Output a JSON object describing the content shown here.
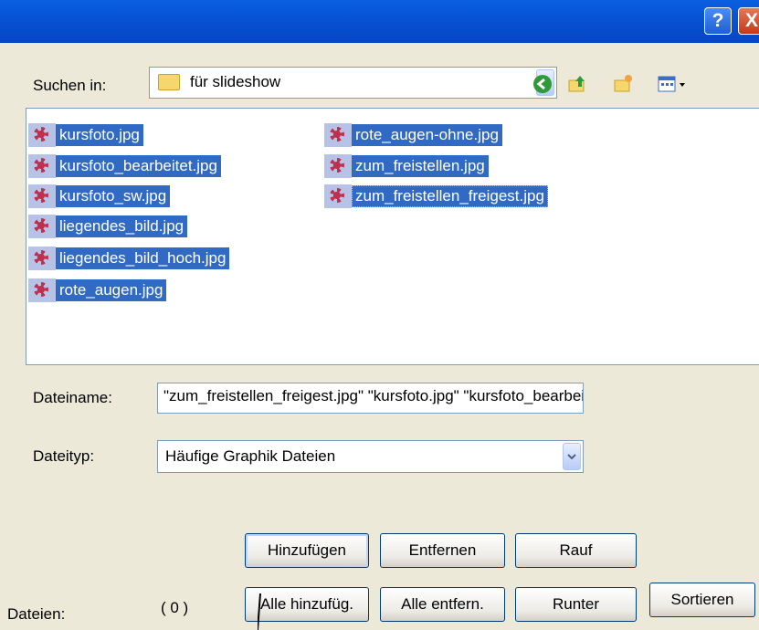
{
  "titlebar": {
    "help_glyph": "?",
    "close_glyph": "X"
  },
  "lookin": {
    "label": "Suchen in:",
    "value": "für slideshow"
  },
  "files": [
    "kursfoto.jpg",
    "kursfoto_bearbeitet.jpg",
    "kursfoto_sw.jpg",
    "liegendes_bild.jpg",
    "liegendes_bild_hoch.jpg",
    "rote_augen.jpg",
    "rote_augen-ohne.jpg",
    "zum_freistellen.jpg",
    "zum_freistellen_freigest.jpg"
  ],
  "filename": {
    "label": "Dateiname:",
    "value": "\"zum_freistellen_freigest.jpg\" \"kursfoto.jpg\" \"kursfoto_bearbeitet.jpg\""
  },
  "filetype": {
    "label": "Dateityp:",
    "value": "Häufige Graphik Dateien"
  },
  "buttons": {
    "add": "Hinzufügen",
    "remove": "Entfernen",
    "up": "Rauf",
    "add_all": "Alle hinzufüg.",
    "remove_all": "Alle entfern.",
    "down": "Runter",
    "sort": "Sortieren"
  },
  "status": {
    "label": "Dateien:",
    "count": "( 0 )"
  },
  "colors": {
    "selection": "#316ac5",
    "titlebar": "#0754d8",
    "dialog_bg": "#ece9d8"
  }
}
